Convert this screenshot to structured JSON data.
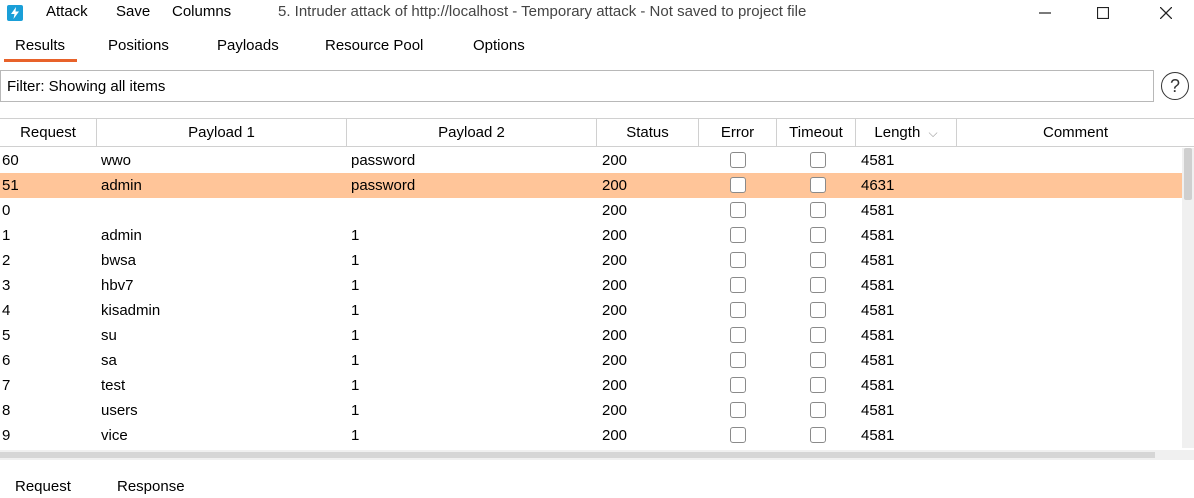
{
  "menu": {
    "attack": "Attack",
    "save": "Save",
    "columns": "Columns"
  },
  "window_title": "5. Intruder attack of http://localhost - Temporary attack - Not saved to project file",
  "window_controls": {
    "minimize": "—",
    "maximize": "☐",
    "close": "✕"
  },
  "tabs": [
    "Results",
    "Positions",
    "Payloads",
    "Resource Pool",
    "Options"
  ],
  "active_tab": "Results",
  "filter": {
    "text": "Filter: Showing all items"
  },
  "help_glyph": "?",
  "table": {
    "headers": [
      "Request",
      "Payload 1",
      "Payload 2",
      "Status",
      "Error",
      "Timeout",
      "Length",
      "Comment"
    ],
    "sort_indicator": "⌵",
    "rows": [
      {
        "request": "60",
        "payload1": "wwo",
        "payload2": "password",
        "status": "200",
        "length": "4581",
        "selected": false
      },
      {
        "request": "51",
        "payload1": "admin",
        "payload2": "password",
        "status": "200",
        "length": "4631",
        "selected": true
      },
      {
        "request": "0",
        "payload1": "",
        "payload2": "",
        "status": "200",
        "length": "4581",
        "selected": false
      },
      {
        "request": "1",
        "payload1": "admin",
        "payload2": "1",
        "status": "200",
        "length": "4581",
        "selected": false
      },
      {
        "request": "2",
        "payload1": "bwsa",
        "payload2": "1",
        "status": "200",
        "length": "4581",
        "selected": false
      },
      {
        "request": "3",
        "payload1": "hbv7",
        "payload2": "1",
        "status": "200",
        "length": "4581",
        "selected": false
      },
      {
        "request": "4",
        "payload1": "kisadmin",
        "payload2": "1",
        "status": "200",
        "length": "4581",
        "selected": false
      },
      {
        "request": "5",
        "payload1": "su",
        "payload2": "1",
        "status": "200",
        "length": "4581",
        "selected": false
      },
      {
        "request": "6",
        "payload1": "sa",
        "payload2": "1",
        "status": "200",
        "length": "4581",
        "selected": false
      },
      {
        "request": "7",
        "payload1": "test",
        "payload2": "1",
        "status": "200",
        "length": "4581",
        "selected": false
      },
      {
        "request": "8",
        "payload1": "users",
        "payload2": "1",
        "status": "200",
        "length": "4581",
        "selected": false
      },
      {
        "request": "9",
        "payload1": "vice",
        "payload2": "1",
        "status": "200",
        "length": "4581",
        "selected": false
      }
    ]
  },
  "bottom_tabs": [
    "Request",
    "Response"
  ],
  "colors": {
    "accent": "#e8622a",
    "selected_row": "#ffc599",
    "app_icon": "#1a9fd8"
  }
}
